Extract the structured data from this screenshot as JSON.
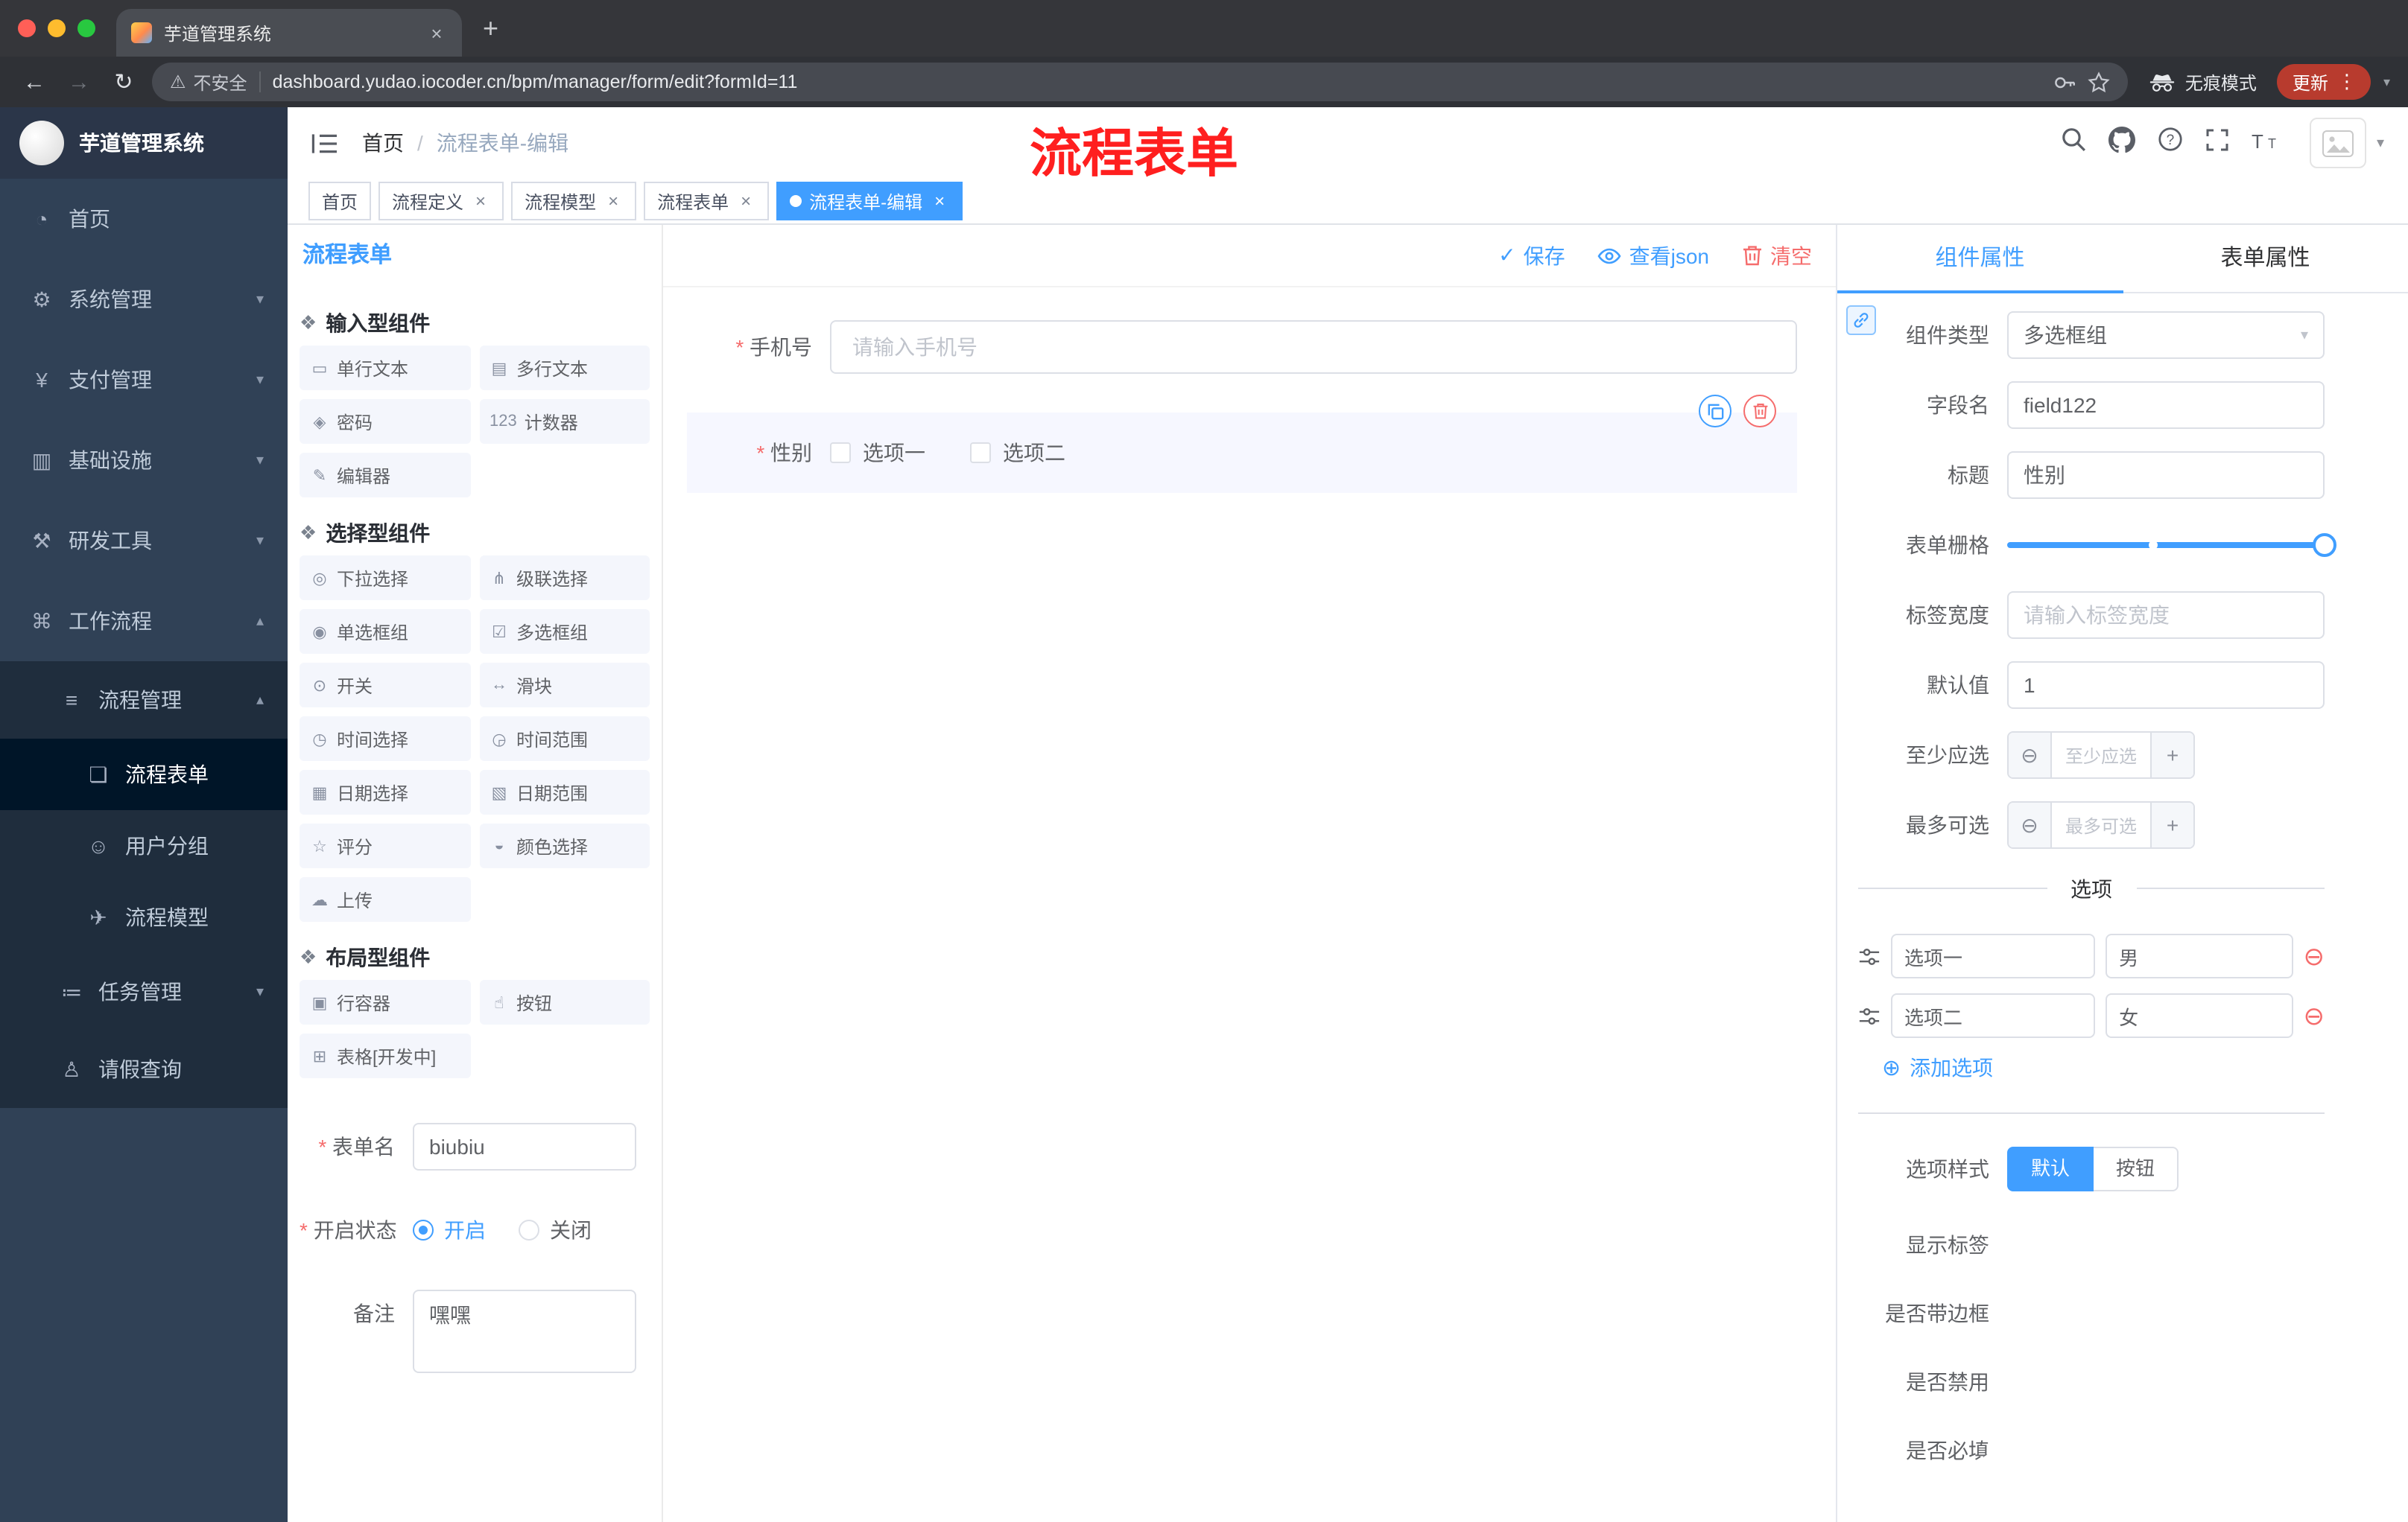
{
  "icons": {
    "component": "❖",
    "single-line-text": "▭",
    "multi-line-text": "▤",
    "password": "◈",
    "counter": "123",
    "editor": "✎",
    "select": "◎",
    "cascader": "⋔",
    "radio-group": "◉",
    "checkbox-group": "☑",
    "switch": "⊙",
    "slider": "↔",
    "time": "◷",
    "time-range": "◶",
    "date": "▦",
    "date-range": "▧",
    "rate": "☆",
    "color": "◒",
    "upload": "☁",
    "row": "▣",
    "button": "☝",
    "table": "⊞",
    "home": "◔",
    "gear": "⚙",
    "yen": "¥",
    "infra": "▥",
    "tools": "⚒",
    "workflow": "⌘",
    "list": "≡",
    "doc": "❏",
    "users": "☺",
    "send": "✈",
    "tasks": "≔",
    "person": "♙",
    "chevron-down": "▾",
    "chevron-up": "▴",
    "caret-down": "▾",
    "back": "←",
    "forward": "→",
    "reload": "↻",
    "dots": "⋮",
    "warning": "⚠",
    "check": "✓",
    "plus-circle": "⊕",
    "minus-circle": "⊖",
    "plus": "+",
    "close": "×",
    "slash": "/"
  },
  "browser": {
    "tab_title": "芋道管理系统",
    "security_label": "不安全",
    "url": "dashboard.yudao.iocoder.cn/bpm/manager/form/edit?formId=11",
    "incognito_label": "无痕模式",
    "update_label": "更新"
  },
  "annotation": {
    "text": "流程表单"
  },
  "sidebar": {
    "logo_title": "芋道管理系统",
    "items": [
      {
        "label": "首页",
        "icon": "home"
      },
      {
        "label": "系统管理",
        "icon": "gear"
      },
      {
        "label": "支付管理",
        "icon": "yen"
      },
      {
        "label": "基础设施",
        "icon": "infra"
      },
      {
        "label": "研发工具",
        "icon": "tools"
      },
      {
        "label": "工作流程",
        "icon": "workflow"
      },
      {
        "label": "流程管理",
        "icon": "list"
      },
      {
        "label": "流程表单",
        "icon": "doc"
      },
      {
        "label": "用户分组",
        "icon": "users"
      },
      {
        "label": "流程模型",
        "icon": "send"
      },
      {
        "label": "任务管理",
        "icon": "tasks"
      },
      {
        "label": "请假查询",
        "icon": "person"
      }
    ]
  },
  "header": {
    "breadcrumb": [
      "首页",
      "流程表单-编辑"
    ]
  },
  "tags": [
    {
      "label": "首页"
    },
    {
      "label": "流程定义"
    },
    {
      "label": "流程模型"
    },
    {
      "label": "流程表单"
    },
    {
      "label": "流程表单-编辑"
    }
  ],
  "palette": {
    "title": "流程表单",
    "groups": {
      "input": {
        "title": "输入型组件",
        "items": [
          {
            "label": "单行文本",
            "icon": "single-line-text"
          },
          {
            "label": "多行文本",
            "icon": "multi-line-text"
          },
          {
            "label": "密码",
            "icon": "password"
          },
          {
            "label": "计数器",
            "icon": "counter"
          },
          {
            "label": "编辑器",
            "icon": "editor"
          }
        ]
      },
      "select": {
        "title": "选择型组件",
        "items": [
          {
            "label": "下拉选择",
            "icon": "select"
          },
          {
            "label": "级联选择",
            "icon": "cascader"
          },
          {
            "label": "单选框组",
            "icon": "radio-group"
          },
          {
            "label": "多选框组",
            "icon": "checkbox-group"
          },
          {
            "label": "开关",
            "icon": "switch"
          },
          {
            "label": "滑块",
            "icon": "slider"
          },
          {
            "label": "时间选择",
            "icon": "time"
          },
          {
            "label": "时间范围",
            "icon": "time-range"
          },
          {
            "label": "日期选择",
            "icon": "date"
          },
          {
            "label": "日期范围",
            "icon": "date-range"
          },
          {
            "label": "评分",
            "icon": "rate"
          },
          {
            "label": "颜色选择",
            "icon": "color"
          },
          {
            "label": "上传",
            "icon": "upload"
          }
        ]
      },
      "layout": {
        "title": "布局型组件",
        "items": [
          {
            "label": "行容器",
            "icon": "row"
          },
          {
            "label": "按钮",
            "icon": "button"
          },
          {
            "label": "表格[开发中]",
            "icon": "table"
          }
        ]
      }
    },
    "form": {
      "name_label": "表单名",
      "name_value": "biubiu",
      "status_label": "开启状态",
      "status_on": "开启",
      "status_off": "关闭",
      "remark_label": "备注",
      "remark_value": "嘿嘿"
    }
  },
  "canvas": {
    "toolbar": {
      "save": "保存",
      "view_json": "查看json",
      "clear": "清空"
    },
    "phone": {
      "label": "手机号",
      "placeholder": "请输入手机号"
    },
    "gender": {
      "label": "性别",
      "options": [
        "选项一",
        "选项二"
      ]
    }
  },
  "props": {
    "tabs": {
      "component": "组件属性",
      "form": "表单属性"
    },
    "component_type": {
      "label": "组件类型",
      "value": "多选框组"
    },
    "field_name": {
      "label": "字段名",
      "value": "field122"
    },
    "title": {
      "label": "标题",
      "value": "性别"
    },
    "grid": {
      "label": "表单栅格"
    },
    "label_width": {
      "label": "标签宽度",
      "placeholder": "请输入标签宽度"
    },
    "default_value": {
      "label": "默认值",
      "value": "1"
    },
    "min_select": {
      "label": "至少应选",
      "placeholder": "至少应选"
    },
    "max_select": {
      "label": "最多可选",
      "placeholder": "最多可选"
    },
    "options_title": "选项",
    "options": [
      {
        "name": "选项一",
        "value": "男"
      },
      {
        "name": "选项二",
        "value": "女"
      }
    ],
    "add_option": "添加选项",
    "option_style": {
      "label": "选项样式",
      "default": "默认",
      "button": "按钮"
    },
    "switches": [
      {
        "label": "显示标签",
        "on": true
      },
      {
        "label": "是否带边框",
        "on": false
      },
      {
        "label": "是否禁用",
        "on": false
      },
      {
        "label": "是否必填",
        "on": true
      }
    ]
  }
}
